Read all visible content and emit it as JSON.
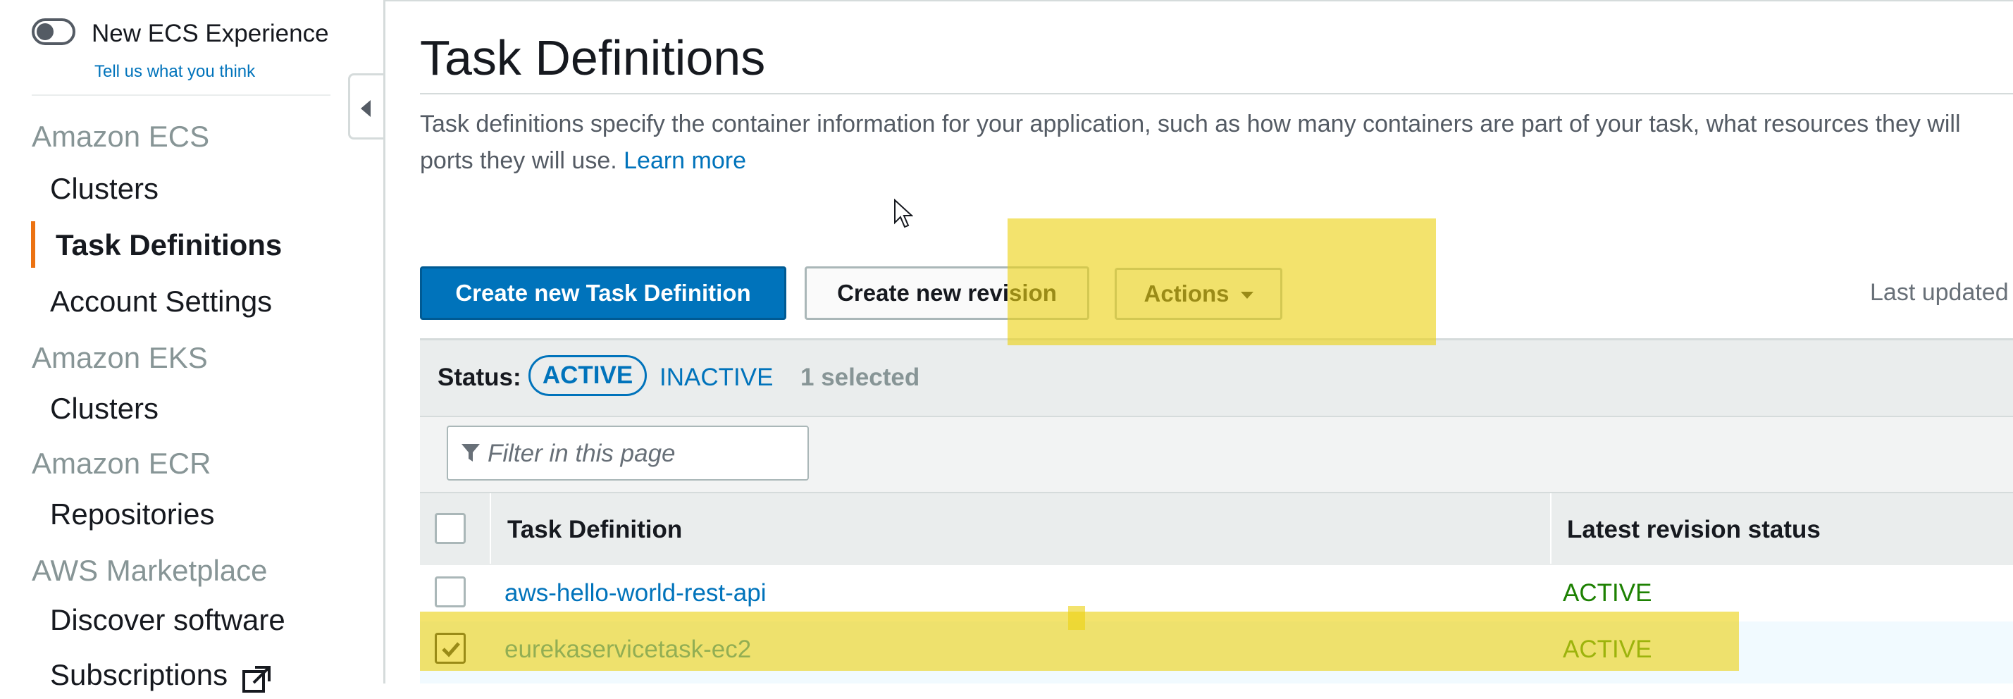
{
  "sidebar": {
    "toggle_label": "New ECS Experience",
    "feedback_link": "Tell us what you think",
    "sections": [
      {
        "title": "Amazon ECS",
        "items": [
          "Clusters",
          "Task Definitions",
          "Account Settings"
        ]
      },
      {
        "title": "Amazon EKS",
        "items": [
          "Clusters"
        ]
      },
      {
        "title": "Amazon ECR",
        "items": [
          "Repositories"
        ]
      },
      {
        "title": "AWS Marketplace",
        "items": [
          "Discover software",
          "Subscriptions"
        ]
      }
    ],
    "active_item": "Task Definitions"
  },
  "main": {
    "title": "Task Definitions",
    "description": "Task definitions specify the container information for your application, such as how many containers are part of your task, what resources they will",
    "description_line2": "ports they will use.",
    "learn_more": "Learn more",
    "buttons": {
      "create": "Create new Task Definition",
      "revision": "Create new revision",
      "actions": "Actions"
    },
    "last_updated": "Last updated"
  },
  "table": {
    "status_label": "Status:",
    "status_filters": [
      "ACTIVE",
      "INACTIVE"
    ],
    "selected_status": "ACTIVE",
    "selected_count": "1 selected",
    "filter_placeholder": "Filter in this page",
    "columns": [
      "Task Definition",
      "Latest revision status"
    ],
    "rows": [
      {
        "name": "aws-hello-world-rest-api",
        "status": "ACTIVE",
        "checked": false
      },
      {
        "name": "eurekaservicetask-ec2",
        "status": "ACTIVE",
        "checked": true
      }
    ]
  },
  "colors": {
    "primary": "#0073bb",
    "active_nav": "#ec7211",
    "status_active": "#1d8102",
    "highlight": "#ecd214"
  },
  "icons": [
    "toggle-icon",
    "collapse-arrow-icon",
    "caret-down-icon",
    "filter-icon",
    "checkmark-icon",
    "external-link-icon",
    "mouse-cursor-icon"
  ]
}
